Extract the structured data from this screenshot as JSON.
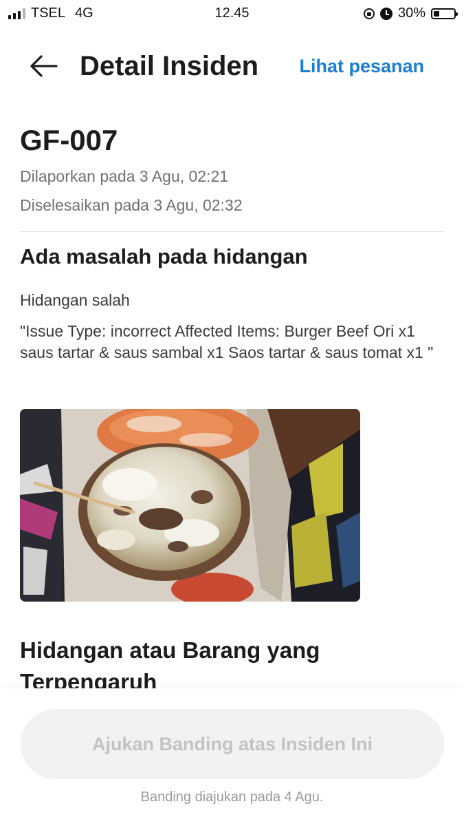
{
  "status_bar": {
    "carrier": "TSEL",
    "network": "4G",
    "time": "12.45",
    "battery": "30%",
    "icons": [
      "signal-icon",
      "rotation-lock-icon",
      "alarm-icon",
      "battery-icon"
    ]
  },
  "header": {
    "back_icon": "arrow-left-icon",
    "title": "Detail Insiden",
    "view_order_link": "Lihat pesanan"
  },
  "incident": {
    "id": "GF-007",
    "reported": "Dilaporkan pada 3 Agu, 02:21",
    "resolved": "Diselesaikan pada 3 Agu, 02:32"
  },
  "issue": {
    "title": "Ada masalah pada hidangan",
    "subtitle": "Hidangan salah",
    "description": "\"Issue Type: incorrect Affected Items: Burger Beef Ori x1 saus tartar & saus sambal x1 Saos tartar & saus tomat x1  \""
  },
  "affected": {
    "title": "Hidangan atau Barang yang Terpengaruh"
  },
  "footer": {
    "appeal_button": "Ajukan Banding atas Insiden Ini",
    "appeal_note": "Banding diajukan pada 4 Agu."
  },
  "colors": {
    "accent": "#1a7ed4",
    "title_text": "#1c1c1c",
    "meta_text": "#707070",
    "disabled_button_bg": "#f2f2f2",
    "disabled_button_text": "#c3c3c3"
  }
}
